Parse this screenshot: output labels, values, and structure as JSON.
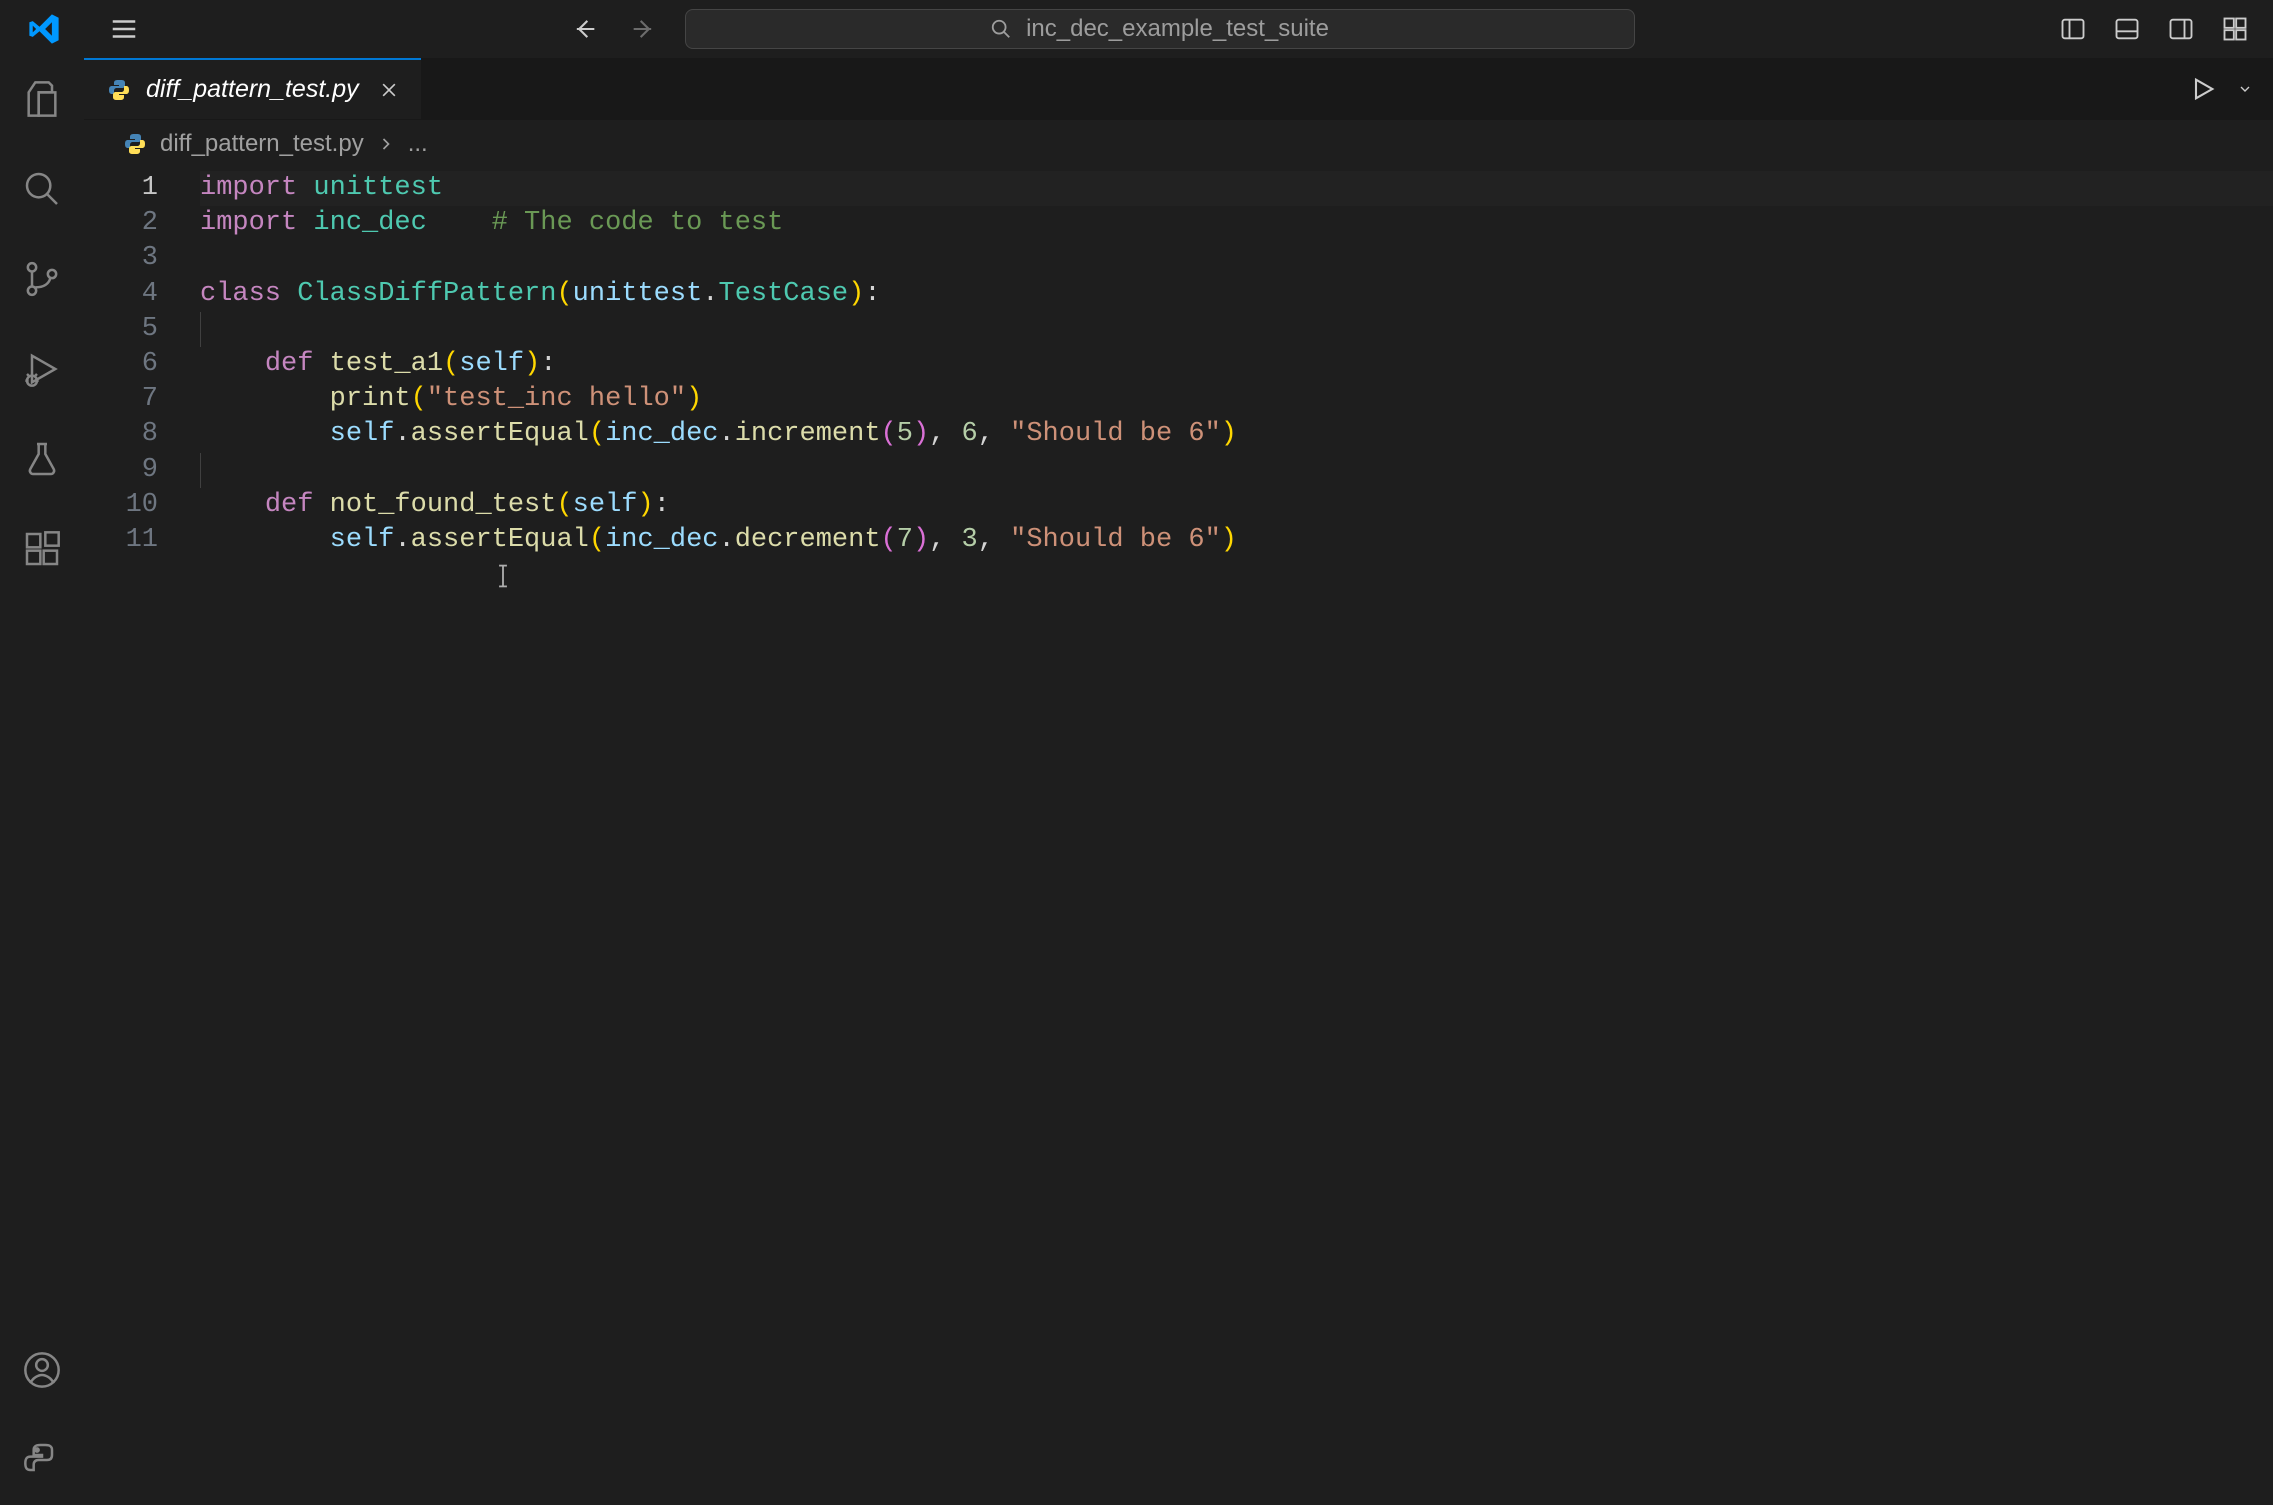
{
  "titlebar": {
    "command_center_text": "inc_dec_example_test_suite"
  },
  "tab": {
    "filename": "diff_pattern_test.py",
    "close_label": "×"
  },
  "breadcrumb": {
    "filename": "diff_pattern_test.py",
    "ellipsis": "..."
  },
  "gutter": {
    "lines": [
      "1",
      "2",
      "3",
      "4",
      "5",
      "6",
      "7",
      "8",
      "9",
      "10",
      "11"
    ],
    "active_line": 1
  },
  "code": {
    "l1": {
      "kw": "import",
      "sp": " ",
      "mod": "unittest"
    },
    "l2": {
      "kw": "import",
      "sp": " ",
      "mod": "inc_dec",
      "pad": "    ",
      "cmt": "# The code to test"
    },
    "l3": "",
    "l4": {
      "kw": "class",
      "sp": " ",
      "cls": "ClassDiffPattern",
      "op": "(",
      "mod": "unittest",
      "dot": ".",
      "tc": "TestCase",
      "cp": ")",
      "colon": ":"
    },
    "l5": "",
    "l6": {
      "indent": "    ",
      "kw": "def",
      "sp": " ",
      "fn": "test_a1",
      "op": "(",
      "prm": "self",
      "cp": ")",
      "colon": ":"
    },
    "l7": {
      "indent": "        ",
      "fn": "print",
      "op": "(",
      "str": "\"test_inc hello\"",
      "cp": ")"
    },
    "l8": {
      "indent": "        ",
      "self": "self",
      "dot1": ".",
      "fn": "assertEqual",
      "op": "(",
      "mod": "inc_dec",
      "dot2": ".",
      "fn2": "increment",
      "op2": "(",
      "n1": "5",
      "cp2": ")",
      "comma1": ", ",
      "n2": "6",
      "comma2": ", ",
      "str": "\"Should be 6\"",
      "cp": ")"
    },
    "l9": "",
    "l10": {
      "indent": "    ",
      "kw": "def",
      "sp": " ",
      "fn": "not_found_test",
      "op": "(",
      "prm": "self",
      "cp": ")",
      "colon": ":"
    },
    "l11": {
      "indent": "        ",
      "self": "self",
      "dot1": ".",
      "fn": "assertEqual",
      "op": "(",
      "mod": "inc_dec",
      "dot2": ".",
      "fn2": "decrement",
      "op2": "(",
      "n1": "7",
      "cp2": ")",
      "comma1": ", ",
      "n2": "3",
      "comma2": ", ",
      "str": "\"Should be 6\"",
      "cp": ")"
    }
  },
  "colors": {
    "accent": "#0078d4",
    "bg": "#1e1e1e",
    "keyword": "#c586c0",
    "type": "#4ec9b0",
    "comment": "#6a9955",
    "function": "#dcdcaa",
    "variable": "#9cdcfe",
    "string": "#ce9178",
    "number": "#b5cea8"
  }
}
